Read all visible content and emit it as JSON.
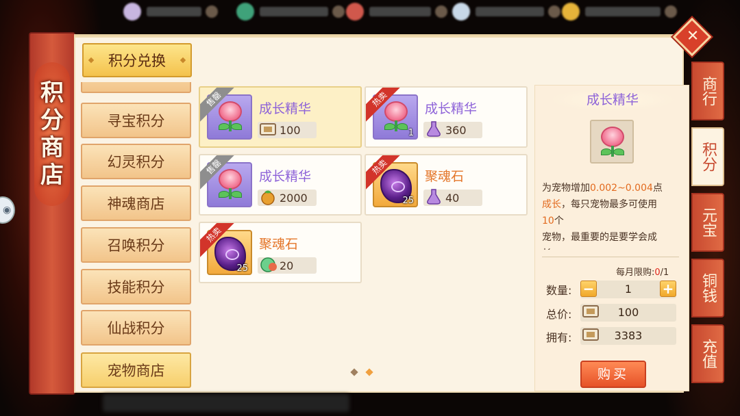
{
  "top_resources": [
    {
      "icon": "pearl-icon",
      "color": "#c8b6e0"
    },
    {
      "icon": "jade-icon",
      "color": "#3fa27a"
    },
    {
      "icon": "red-gem-icon",
      "color": "#d0584c"
    },
    {
      "icon": "cloud-icon",
      "color": "#c8d8e8"
    },
    {
      "icon": "gold-coin-icon",
      "color": "#e6b43a"
    }
  ],
  "banner": {
    "title_chars": [
      "积",
      "分",
      "商",
      "店"
    ]
  },
  "sidebar": {
    "header_label": "积分兑换",
    "items": [
      {
        "label": "寻宝积分"
      },
      {
        "label": "幻灵积分"
      },
      {
        "label": "神魂商店"
      },
      {
        "label": "召唤积分"
      },
      {
        "label": "技能积分"
      },
      {
        "label": "仙战积分"
      },
      {
        "label": "宠物商店"
      }
    ]
  },
  "items": [
    {
      "name": "成长精华",
      "tag": "售罄",
      "price": "100",
      "count": "",
      "icon": "growth-essence-icon",
      "currency_icon": "coupon-icon"
    },
    {
      "name": "成长精华",
      "tag": "热卖",
      "price": "360",
      "count": "1",
      "icon": "growth-essence-icon",
      "currency_icon": "potion-icon"
    },
    {
      "name": "成长精华",
      "tag": "售罄",
      "price": "2000",
      "count": "",
      "icon": "growth-essence-icon",
      "currency_icon": "fruit-icon"
    },
    {
      "name": "聚魂石",
      "tag": "热卖",
      "price": "40",
      "count": "25",
      "icon": "soul-stone-icon",
      "currency_icon": "potion-icon"
    },
    {
      "name": "聚魂石",
      "tag": "热卖",
      "price": "20",
      "count": "25",
      "icon": "soul-stone-icon",
      "currency_icon": "orb-icon"
    }
  ],
  "detail": {
    "title": "成长精华",
    "desc_parts": [
      "为宠物增加",
      "0.002~0.004",
      "点",
      "成长",
      "，每只宠物最多可使用",
      "10",
      "个",
      "宠物，最重要的是要学会成",
      "长"
    ],
    "limit_label": "每月限购:",
    "limit_used": "0",
    "limit_total": "/1",
    "qty_label": "数量:",
    "qty": "1",
    "total_label": "总价:",
    "total": "100",
    "own_label": "拥有:",
    "own": "3383",
    "buy_label": "购买",
    "minus": "−",
    "plus": "+"
  },
  "right_tabs": [
    {
      "label": "商行",
      "selected": false
    },
    {
      "label": "积分",
      "selected": true
    },
    {
      "label": "元宝",
      "selected": false
    },
    {
      "label": "铜钱",
      "selected": false
    },
    {
      "label": "充值",
      "selected": false
    }
  ],
  "close_glyph": "✕",
  "pagination": {
    "count": 2,
    "current": 1,
    "colors": {
      "inactive": "#a08060",
      "active": "#f0a040"
    }
  },
  "colors": {
    "accent_purple": "#8d62d8",
    "accent_orange": "#e4762a",
    "tab_red": "#c84a30"
  }
}
